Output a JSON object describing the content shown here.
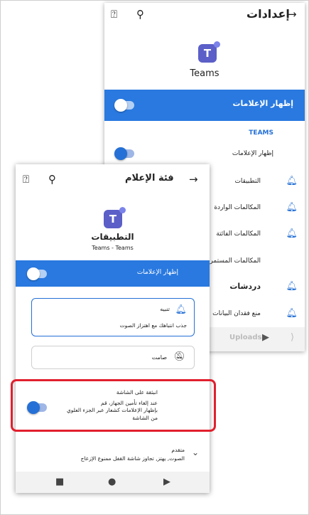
{
  "back_panel": {
    "title": "إعدادات",
    "back_icon": "arrow-right-icon",
    "search_icon": "search-icon",
    "help_icon": "help-icon",
    "app_name": "Teams",
    "show_notifications_label": "إظهار الإعلامات",
    "section_label": "TEAMS",
    "teams_show_notifications": "إظهار الإعلامات",
    "rows": [
      {
        "label": "التطبيقات"
      },
      {
        "label": "المكالمات الواردة"
      },
      {
        "label": "المكالمات الفائتة"
      },
      {
        "label": "المكالمات المستمرة"
      }
    ],
    "chat_section": "دردشات",
    "data_loss_row": "منع فقدان البيانات",
    "uploads_label": "Uploads"
  },
  "front_panel": {
    "title": "فئة الإعلام",
    "back_icon": "arrow-right-icon",
    "search_icon": "search-icon",
    "help_icon": "help-icon",
    "app_title": "التطبيقات",
    "app_subtitle": "Teams - Teams",
    "show_notifications_label": "إظهار الإعلامات",
    "alert_option": {
      "title": "تنبيه",
      "desc": "جذب انتباهك مع اهتزاز الصوت"
    },
    "silent_option": {
      "title": "صامت"
    },
    "lockscreen": {
      "line1": "انبثقة على الشاشة",
      "line2": "عند إلغاء تأمين الجهاز، قم",
      "line3": "بإظهار الإعلامات كشعار عبر الجزء العلوي",
      "line4": "من الشاشة"
    },
    "advanced": {
      "title": "متقدم",
      "desc": "الصوت, يهتز, تجاوز شاشة القفل ممنوع الإزعاج"
    }
  },
  "colors": {
    "accent": "#2470d6",
    "blue_bar": "#2979e0",
    "teams_purple": "#5b5fc7",
    "highlight_red": "#e0202e"
  }
}
